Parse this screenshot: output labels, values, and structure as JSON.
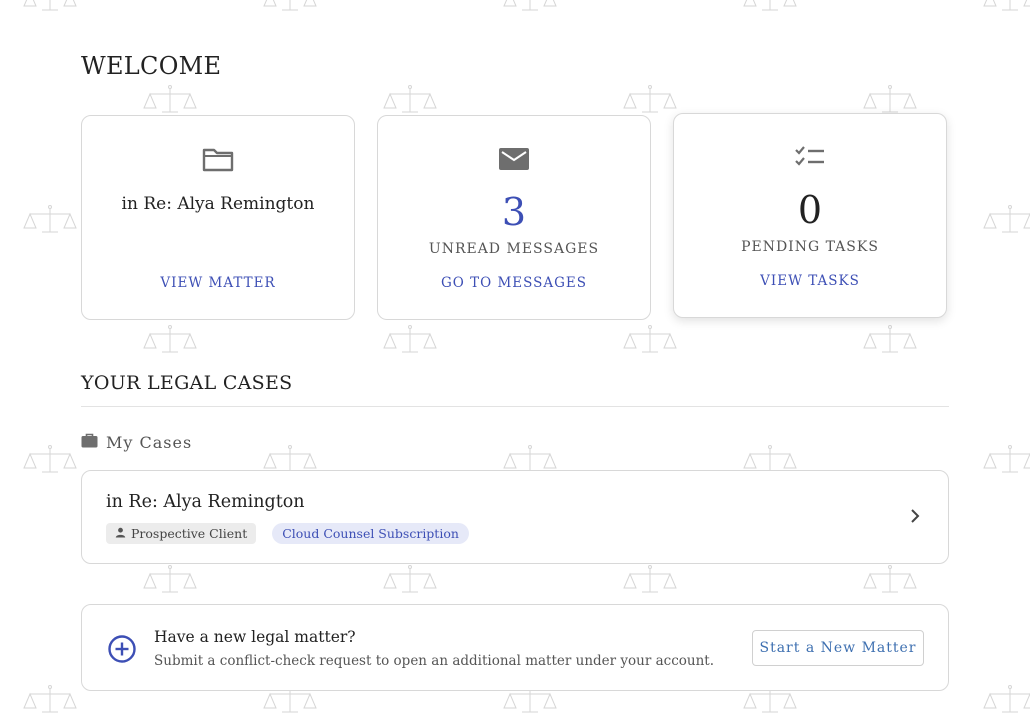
{
  "welcome": {
    "title": "WELCOME"
  },
  "cards": {
    "matter": {
      "icon": "folder-icon",
      "text": "in Re: Alya Remington",
      "link": "VIEW MATTER"
    },
    "messages": {
      "icon": "envelope-icon",
      "count": "3",
      "label": "UNREAD MESSAGES",
      "link": "GO TO MESSAGES"
    },
    "tasks": {
      "icon": "checklist-icon",
      "count": "0",
      "label": "PENDING TASKS",
      "link": "VIEW TASKS"
    }
  },
  "cases": {
    "title": "YOUR LEGAL CASES",
    "section_label": "My Cases",
    "section_icon": "briefcase-icon",
    "items": [
      {
        "title": "in Re: Alya Remington",
        "role_tag": "Prospective Client",
        "role_icon": "person-icon",
        "plan_tag": "Cloud Counsel Subscription"
      }
    ]
  },
  "new_matter": {
    "icon": "plus-circle-icon",
    "title": "Have a new legal matter?",
    "description": "Submit a conflict-check request to open an additional matter under your account.",
    "button": "Start a New Matter"
  },
  "colors": {
    "accent": "#3d4fb5",
    "button_text": "#3d6fb0",
    "tag_blue_bg": "#e6e9f8",
    "tag_grey_bg": "#ececec",
    "border": "#d8d8d8",
    "watermark": "#d6d6d6"
  }
}
